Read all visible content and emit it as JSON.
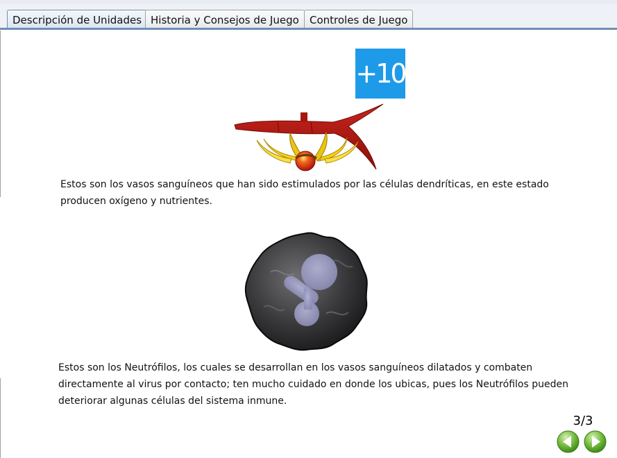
{
  "tabs": [
    {
      "label": "Descripción de Unidades",
      "active": true
    },
    {
      "label": "Historia y Consejos de Juego",
      "active": false
    },
    {
      "label": "Controles de Juego",
      "active": false
    }
  ],
  "section1": {
    "badge_text": "+10",
    "description": "Estos son los vasos sanguíneos que han sido estimulados por las células dendríticas, en este estado producen oxígeno y nutrientes."
  },
  "section2": {
    "description": "Estos son los Neutrófilos, los cuales se desarrollan en los vasos sanguíneos dilatados y combaten directamente al virus por contacto; ten mucho cuidado en donde los ubicas, pues los Neutrófilos pueden deteriorar algunas células del sistema inmune."
  },
  "pagination": {
    "page_indicator": "3/3"
  },
  "icons": {
    "prev": "arrow-left-icon",
    "next": "arrow-right-icon"
  },
  "colors": {
    "badge": "#1e9be8",
    "nav_button": "#5fae2a",
    "active_tab_border": "#6f8fb3",
    "vessel": "#b01a14"
  }
}
